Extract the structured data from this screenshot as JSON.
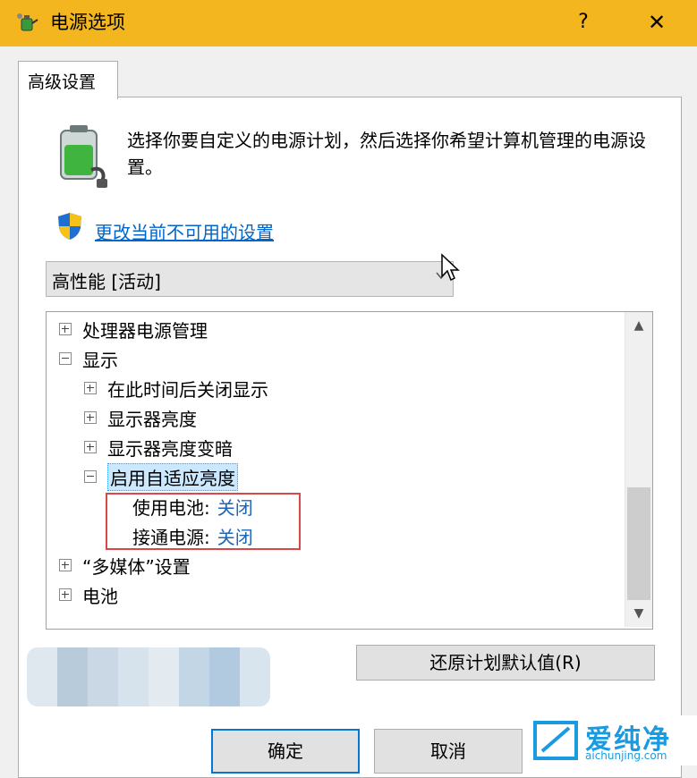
{
  "window": {
    "title": "电源选项",
    "help_glyph": "?",
    "close_glyph": "✕"
  },
  "tabs": [
    {
      "label": "高级设置"
    }
  ],
  "description": "选择你要自定义的电源计划，然后选择你希望计算机管理的电源设置。",
  "change_link": "更改当前不可用的设置",
  "plan_select": {
    "value": "高性能 [活动]"
  },
  "tree": {
    "items": [
      {
        "label": "处理器电源管理",
        "expander": "plus"
      },
      {
        "label": "显示",
        "expander": "minus"
      },
      {
        "label": "在此时间后关闭显示",
        "expander": "plus"
      },
      {
        "label": "显示器亮度",
        "expander": "plus"
      },
      {
        "label": "显示器亮度变暗",
        "expander": "plus"
      },
      {
        "label": "启用自适应亮度",
        "expander": "minus",
        "selected": true
      },
      {
        "label": "使用电池:",
        "value": "关闭"
      },
      {
        "label": "接通电源:",
        "value": "关闭"
      },
      {
        "label": "“多媒体”设置",
        "expander": "plus"
      },
      {
        "label": "电池",
        "expander": "plus"
      }
    ]
  },
  "buttons": {
    "restore": "还原计划默认值(R)",
    "ok": "确定",
    "cancel": "取消"
  },
  "watermark": {
    "brand": "爱纯净",
    "url": "aichunjing.com"
  },
  "colors": {
    "titlebar": "#f4b61f",
    "link": "#0066cc",
    "selection": "#cce8ff",
    "highlight_box": "#d84848",
    "value_text": "#1e66b4"
  }
}
